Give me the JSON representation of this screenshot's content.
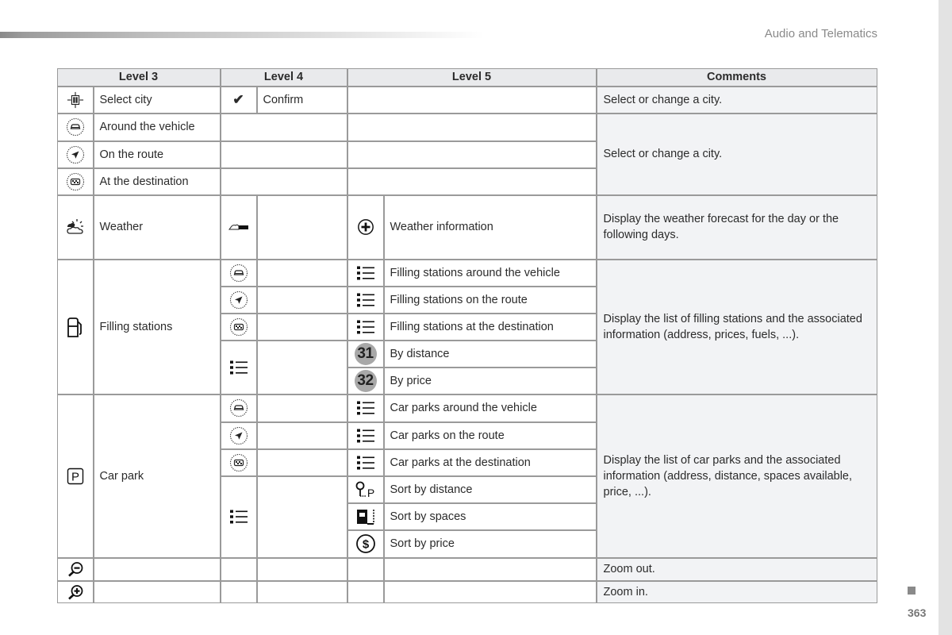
{
  "page": {
    "section_title": "Audio and Telematics",
    "page_number": "363"
  },
  "table": {
    "headers": [
      "Level 3",
      "Level 4",
      "Level 5",
      "Comments"
    ],
    "select_city": {
      "level3_icon": "crosshair-map-icon",
      "level3_label": "Select city",
      "level4_icon": "checkmark-icon",
      "level4_label": "Confirm",
      "comment": "Select or change a city."
    },
    "location_rows": [
      {
        "icon": "around-vehicle-icon",
        "label": "Around the vehicle"
      },
      {
        "icon": "on-route-icon",
        "label": "On the route"
      },
      {
        "icon": "at-destination-icon",
        "label": "At the destination"
      }
    ],
    "location_comment": "Select or change a city.",
    "weather": {
      "level3_icon": "weather-icon",
      "level3_label": "Weather",
      "level4_icon": "weather-toggle-icon",
      "level5_icon": "plus-circle-icon",
      "level5_label": "Weather information",
      "comment": "Display the weather forecast for the day or the following days."
    },
    "filling": {
      "level3_icon": "fuel-pump-icon",
      "level3_label": "Filling stations",
      "rows": [
        {
          "level4_icon": "around-vehicle-icon",
          "level5_icon": "list-icon",
          "label": "Filling stations around the vehicle"
        },
        {
          "level4_icon": "on-route-icon",
          "level5_icon": "list-icon",
          "label": "Filling stations on the route"
        },
        {
          "level4_icon": "at-destination-icon",
          "level5_icon": "list-icon",
          "label": "Filling stations at the destination"
        }
      ],
      "sort_icon": "list-icon",
      "sort_rows": [
        {
          "badge": "31",
          "label": "By distance"
        },
        {
          "badge": "32",
          "label": "By price"
        }
      ],
      "comment": "Display the list of filling stations and the associated information (address, prices, fuels, ...)."
    },
    "carpark": {
      "level3_icon": "parking-icon",
      "level3_label": "Car park",
      "rows": [
        {
          "level4_icon": "around-vehicle-icon",
          "level5_icon": "list-icon",
          "label": "Car parks around the vehicle"
        },
        {
          "level4_icon": "on-route-icon",
          "level5_icon": "list-icon",
          "label": "Car parks on the route"
        },
        {
          "level4_icon": "at-destination-icon",
          "level5_icon": "list-icon",
          "label": "Car parks at the destination"
        }
      ],
      "sort_icon": "list-icon",
      "sort_rows": [
        {
          "icon": "sort-distance-icon",
          "label": "Sort by distance"
        },
        {
          "icon": "sort-spaces-icon",
          "label": "Sort by spaces"
        },
        {
          "icon": "sort-price-icon",
          "label": "Sort by price"
        }
      ],
      "comment": "Display the list of car parks and the associated information (address, distance, spaces available, price, ...)."
    },
    "zoom_out": {
      "icon": "zoom-out-icon",
      "comment": "Zoom out."
    },
    "zoom_in": {
      "icon": "zoom-in-icon",
      "comment": "Zoom in."
    }
  }
}
